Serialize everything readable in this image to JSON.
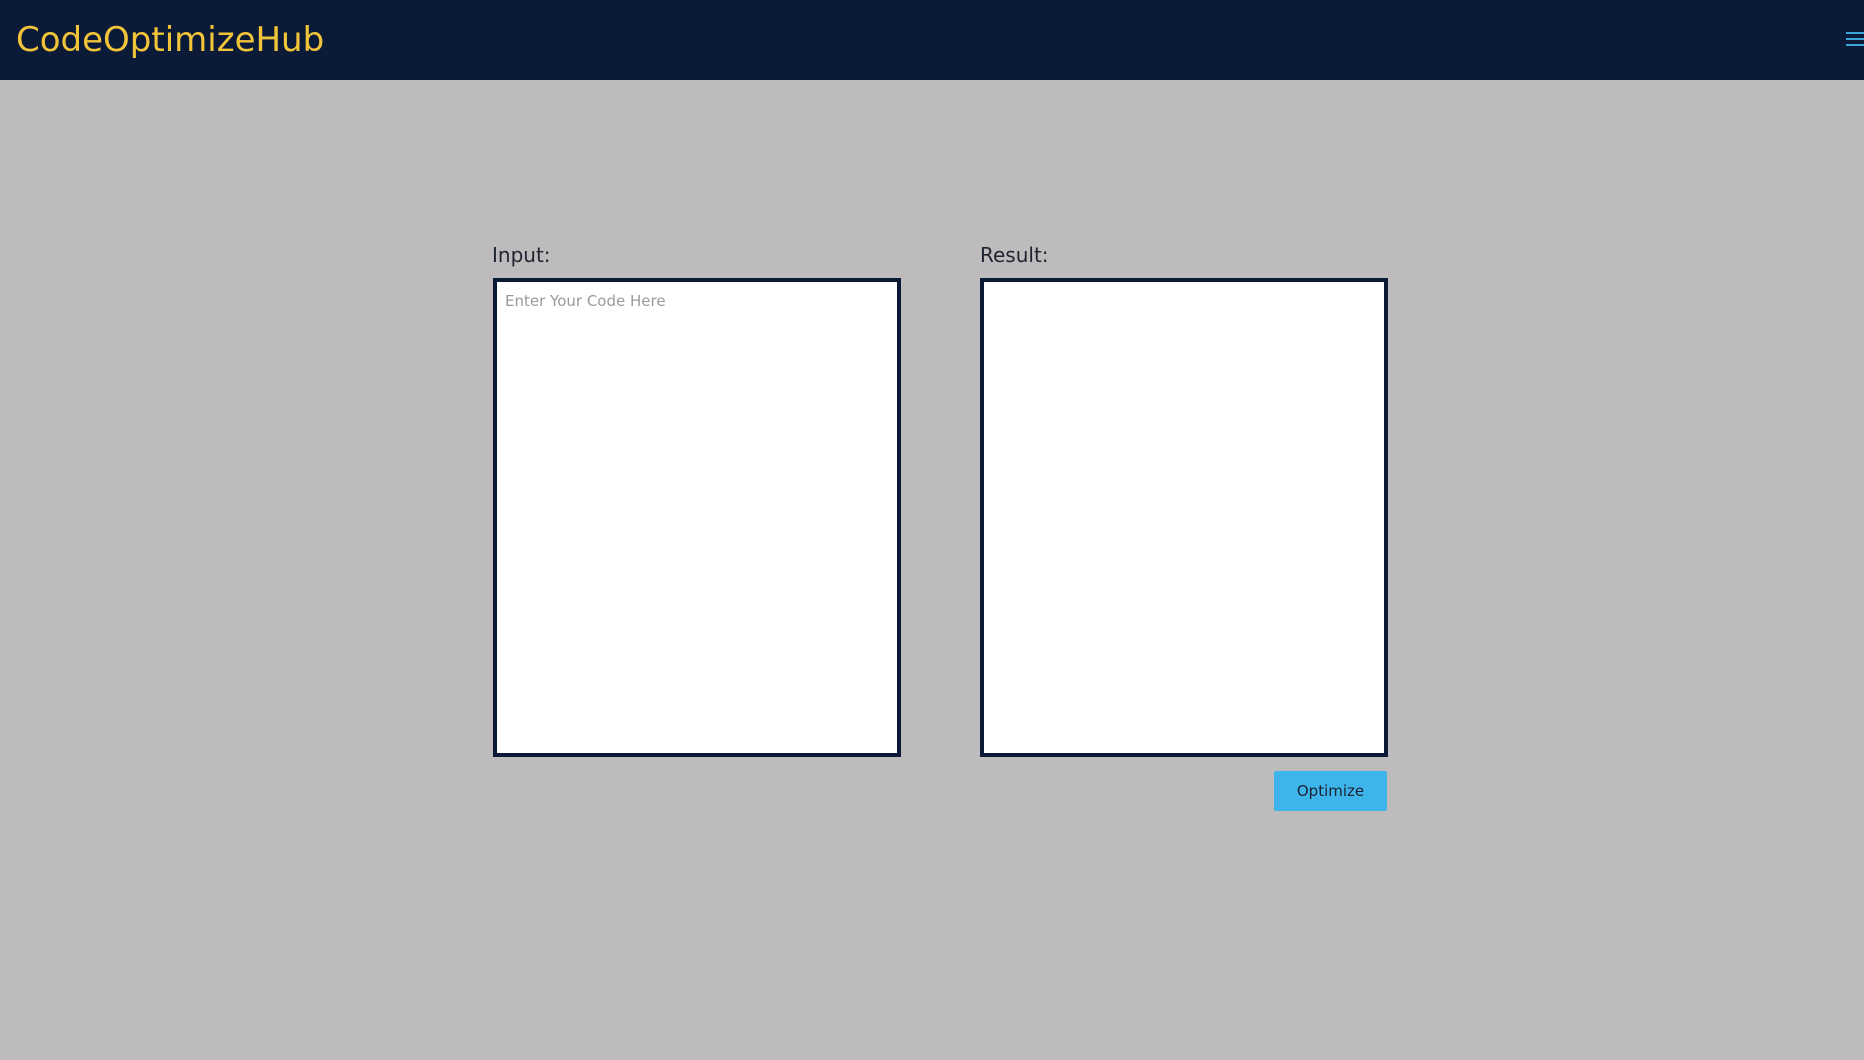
{
  "navbar": {
    "brand": "CodeOptimizeHub",
    "menu_icon": "hamburger-menu-icon"
  },
  "editor": {
    "input_label": "Input:",
    "input_placeholder": "Enter Your Code Here",
    "input_value": "",
    "result_label": "Result:",
    "result_value": "",
    "optimize_label": "Optimize"
  },
  "colors": {
    "navbar_bg": "#0b1b37",
    "brand_text": "#f2c43a",
    "page_bg": "#bdbbbc",
    "button_bg": "#3db4ea",
    "menu_icon": "#3aa6dc"
  }
}
